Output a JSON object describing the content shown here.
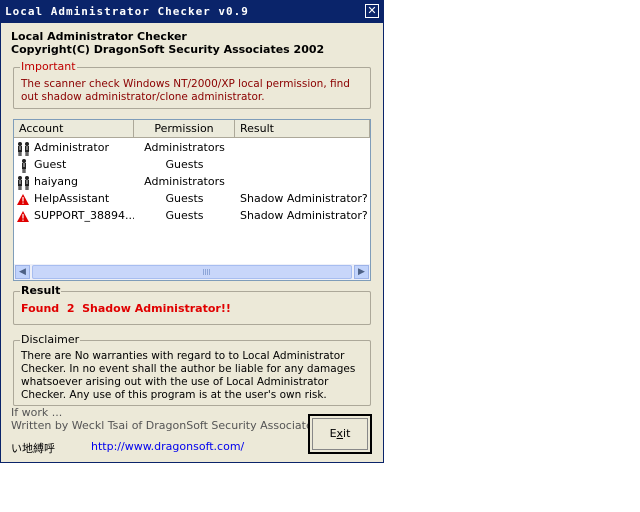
{
  "window": {
    "title": "Local Administrator Checker v0.9",
    "close_label": "✕"
  },
  "header": {
    "app_name": "Local Administrator Checker",
    "copyright": "Copyright(C) DragonSoft Security Associates 2002"
  },
  "important": {
    "legend": "Important",
    "text": "The scanner check Windows NT/2000/XP local permission, find out shadow administrator/clone administrator."
  },
  "table": {
    "columns": [
      "Account",
      "Permission",
      "Result"
    ],
    "rows": [
      {
        "account": "Administrator",
        "permission": "Administrators",
        "result": "",
        "icon": "users-icon"
      },
      {
        "account": "Guest",
        "permission": "Guests",
        "result": "",
        "icon": "user-icon"
      },
      {
        "account": "haiyang",
        "permission": "Administrators",
        "result": "",
        "icon": "users-icon"
      },
      {
        "account": "HelpAssistant",
        "permission": "Guests",
        "result": "Shadow Administrator?",
        "icon": "warning-icon"
      },
      {
        "account": "SUPPORT_38894...",
        "permission": "Guests",
        "result": "Shadow Administrator?",
        "icon": "warning-icon"
      }
    ]
  },
  "result": {
    "legend": "Result",
    "text": "Found  2  Shadow Administrator!!"
  },
  "disclaimer": {
    "legend": "Disclaimer",
    "text": "There are No warranties with regard to to Local Administrator Checker. In no event shall the author be liable for any damages whatsoever arising out with the use of Local Administrator Checker. Any use of this program is at the user's own risk."
  },
  "footer": {
    "if_work": "If work ...",
    "author": "Written by Weckl Tsai of DragonSoft Security Associates.",
    "extra": "い地縛呼",
    "link": "http://www.dragonsoft.com/",
    "exit_prefix": "E",
    "exit_accel": "x",
    "exit_suffix": "it"
  },
  "colors": {
    "titlebar": "#0a246a",
    "accent_red": "#e00000",
    "link": "#0000ee"
  }
}
